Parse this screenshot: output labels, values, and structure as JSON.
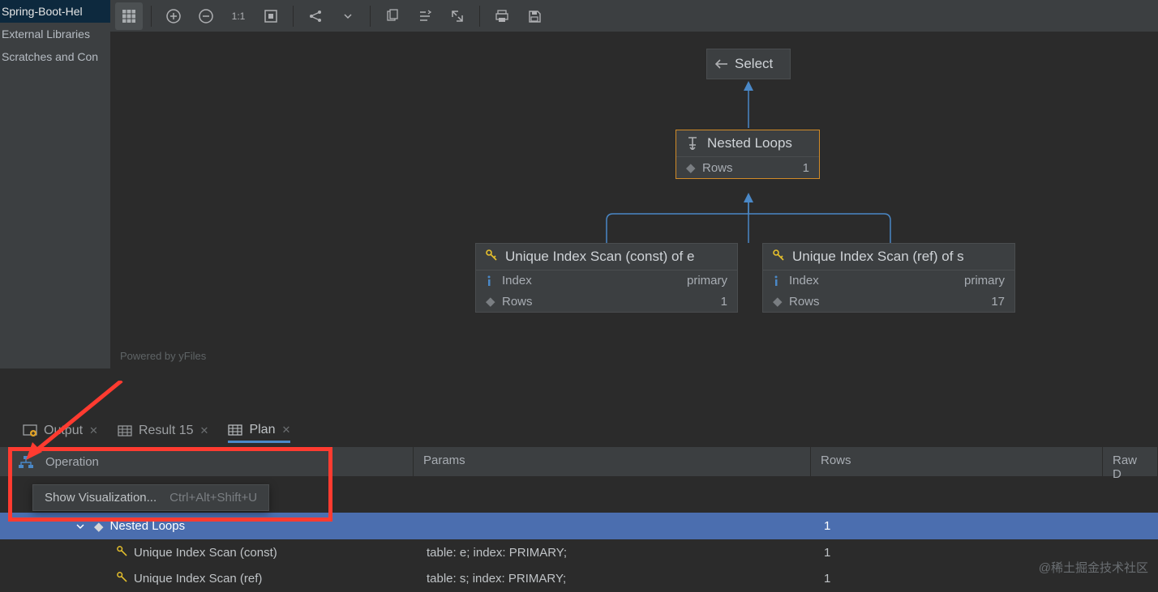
{
  "sidebar": {
    "items": [
      "Spring-Boot-Hel",
      "External Libraries",
      "Scratches and Con"
    ]
  },
  "toolbar": {
    "grid": "grid-icon",
    "zoom11": "1:1"
  },
  "diagram": {
    "powered": "Powered by yFiles",
    "select_label": "Select",
    "nested": {
      "title": "Nested Loops",
      "rows_label": "Rows",
      "rows_val": "1"
    },
    "left": {
      "title": "Unique Index Scan (const) of e",
      "index_label": "Index",
      "index_val": "primary",
      "rows_label": "Rows",
      "rows_val": "1"
    },
    "right": {
      "title": "Unique Index Scan (ref) of s",
      "index_label": "Index",
      "index_val": "primary",
      "rows_label": "Rows",
      "rows_val": "17"
    }
  },
  "bottom_tabs": {
    "output": "Output",
    "result": "Result 15",
    "plan": "Plan"
  },
  "plan": {
    "headers": {
      "op": "Operation",
      "params": "Params",
      "rows": "Rows",
      "raw": "Raw D"
    },
    "rows": [
      {
        "op": "Nested Loops",
        "params": "",
        "rows": "1"
      },
      {
        "op": "Unique Index Scan (const)",
        "params": "table: e; index: PRIMARY;",
        "rows": "1"
      },
      {
        "op": "Unique Index Scan (ref)",
        "params": "table: s; index: PRIMARY;",
        "rows": "1"
      }
    ]
  },
  "popup": {
    "label": "Show Visualization...",
    "shortcut": "Ctrl+Alt+Shift+U"
  },
  "watermark": "@稀土掘金技术社区"
}
